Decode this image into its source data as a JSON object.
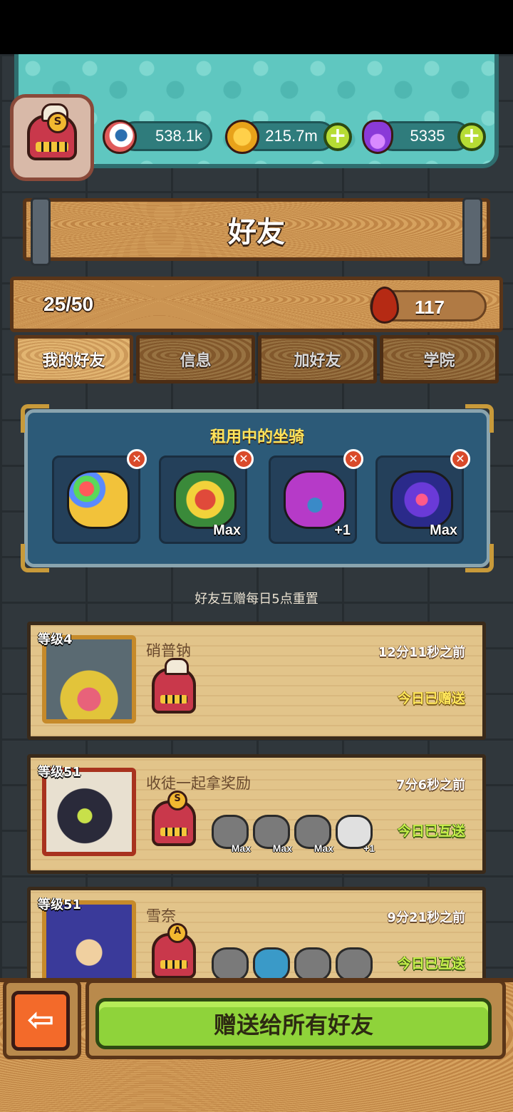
{
  "header": {
    "player_rank": "S",
    "resources": [
      {
        "icon": "eyeball-icon",
        "value": "538.1k"
      },
      {
        "icon": "gold-coin-icon",
        "value": "215.7m"
      },
      {
        "icon": "potion-icon",
        "value": "5335"
      }
    ]
  },
  "page_title": "好友",
  "friend_count": "25/50",
  "blood_value": "117",
  "tabs": [
    {
      "label": "我的好友",
      "active": true
    },
    {
      "label": "信息",
      "active": false
    },
    {
      "label": "加好友",
      "active": false
    },
    {
      "label": "学院",
      "active": false
    }
  ],
  "mounts_panel": {
    "title": "租用中的坐骑",
    "slots": [
      {
        "name": "balloon-chick-mount",
        "level": ""
      },
      {
        "name": "lion-dance-mount",
        "level": "Max"
      },
      {
        "name": "purple-horned-mount",
        "level": "+1"
      },
      {
        "name": "blue-rose-mount",
        "level": "Max"
      }
    ]
  },
  "reset_note": "好友互赠每日5点重置",
  "friends": [
    {
      "level": "等级4",
      "name": "硝普钠",
      "time": "12分11秒之前",
      "status": "今日已赠送",
      "rank": "",
      "mounts": []
    },
    {
      "level": "等级51",
      "name": "收徒一起拿奖励",
      "time": "7分6秒之前",
      "status": "今日已互送",
      "rank": "S",
      "mounts": [
        "Max",
        "Max",
        "Max",
        "+1"
      ]
    },
    {
      "level": "等级51",
      "name": "雪奈",
      "time": "9分21秒之前",
      "status": "今日已互送",
      "rank": "A",
      "mounts": [
        "",
        "",
        "",
        ""
      ]
    }
  ],
  "bottom": {
    "send_all_label": "赠送给所有好友"
  },
  "colors": {
    "teal_panel": "#5fc7c0",
    "wood": "#c98f4c",
    "mount_panel": "#2c5a78",
    "send_button": "#8fd33a",
    "back_button": "#f36a2a"
  }
}
